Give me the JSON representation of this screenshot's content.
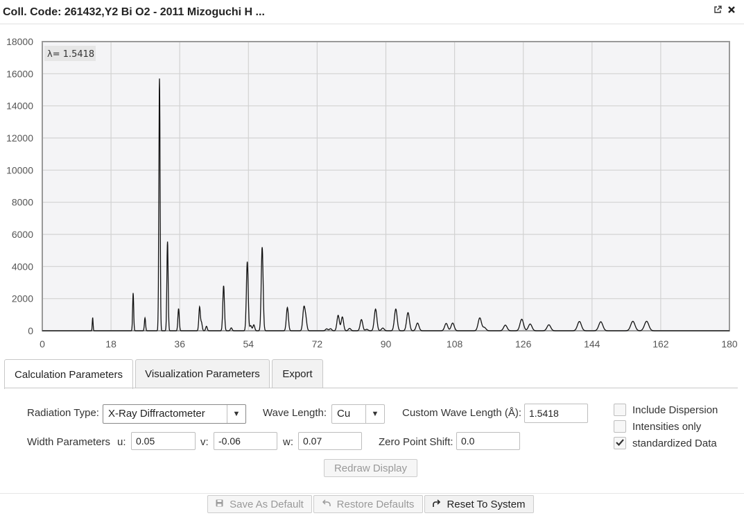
{
  "window": {
    "title": "Coll. Code: 261432,Y2 Bi O2 - 2011 Mizoguchi H ...",
    "popout_icon": "external-link-icon",
    "close_icon": "close-icon"
  },
  "chart_data": {
    "type": "line",
    "annotation": "λ= 1.5418",
    "xlim": [
      0,
      180
    ],
    "ylim": [
      0,
      18000
    ],
    "x_ticks": [
      0,
      18,
      36,
      54,
      72,
      90,
      108,
      126,
      144,
      162,
      180
    ],
    "y_ticks": [
      0,
      2000,
      4000,
      6000,
      8000,
      10000,
      12000,
      14000,
      16000,
      18000
    ],
    "grid": true,
    "series": [
      {
        "peaks": [
          {
            "x": 13.2,
            "y": 820
          },
          {
            "x": 23.8,
            "y": 2350
          },
          {
            "x": 26.9,
            "y": 800
          },
          {
            "x": 30.7,
            "y": 15700
          },
          {
            "x": 32.8,
            "y": 5550
          },
          {
            "x": 35.7,
            "y": 1380
          },
          {
            "x": 41.2,
            "y": 1480
          },
          {
            "x": 41.7,
            "y": 500
          },
          {
            "x": 43.0,
            "y": 280
          },
          {
            "x": 47.5,
            "y": 2800
          },
          {
            "x": 49.5,
            "y": 180
          },
          {
            "x": 53.7,
            "y": 4300
          },
          {
            "x": 54.6,
            "y": 320
          },
          {
            "x": 55.4,
            "y": 370
          },
          {
            "x": 57.6,
            "y": 5200
          },
          {
            "x": 64.2,
            "y": 1450
          },
          {
            "x": 68.5,
            "y": 1330
          },
          {
            "x": 69.0,
            "y": 780
          },
          {
            "x": 74.5,
            "y": 120
          },
          {
            "x": 75.5,
            "y": 130
          },
          {
            "x": 77.5,
            "y": 960
          },
          {
            "x": 78.6,
            "y": 860
          },
          {
            "x": 80.5,
            "y": 150
          },
          {
            "x": 83.6,
            "y": 700
          },
          {
            "x": 85.0,
            "y": 90
          },
          {
            "x": 87.3,
            "y": 1350
          },
          {
            "x": 89.2,
            "y": 170
          },
          {
            "x": 92.6,
            "y": 1350
          },
          {
            "x": 95.8,
            "y": 1130
          },
          {
            "x": 98.3,
            "y": 480
          },
          {
            "x": 105.8,
            "y": 460
          },
          {
            "x": 107.5,
            "y": 480
          },
          {
            "x": 114.6,
            "y": 800
          },
          {
            "x": 115.8,
            "y": 200
          },
          {
            "x": 121.3,
            "y": 350
          },
          {
            "x": 125.6,
            "y": 720
          },
          {
            "x": 127.8,
            "y": 420
          },
          {
            "x": 132.7,
            "y": 370
          },
          {
            "x": 140.7,
            "y": 580
          },
          {
            "x": 146.3,
            "y": 560
          },
          {
            "x": 154.7,
            "y": 590
          },
          {
            "x": 158.3,
            "y": 590
          }
        ]
      }
    ]
  },
  "tabs": [
    {
      "label": "Calculation Parameters",
      "active": true
    },
    {
      "label": "Visualization Parameters",
      "active": false
    },
    {
      "label": "Export",
      "active": false
    }
  ],
  "form": {
    "radiation_type_label": "Radiation Type:",
    "radiation_type_value": "X-Ray Diffractometer",
    "wave_length_label": "Wave Length:",
    "wave_length_value": "Cu",
    "custom_wave_label": "Custom Wave Length (Å):",
    "custom_wave_value": "1.5418",
    "width_params_label": "Width Parameters",
    "u_label": "u:",
    "u_value": "0.05",
    "v_label": "v:",
    "v_value": "-0.06",
    "w_label": "w:",
    "w_value": "0.07",
    "zero_shift_label": "Zero Point Shift:",
    "zero_shift_value": "0.0",
    "include_dispersion_label": "Include Dispersion",
    "include_dispersion_checked": false,
    "intensities_only_label": "Intensities only",
    "intensities_only_checked": false,
    "standardized_label": "standardized Data",
    "standardized_checked": true,
    "redraw_label": "Redraw Display"
  },
  "footer": {
    "save_default_label": "Save As Default",
    "restore_defaults_label": "Restore Defaults",
    "reset_system_label": "Reset To System"
  }
}
